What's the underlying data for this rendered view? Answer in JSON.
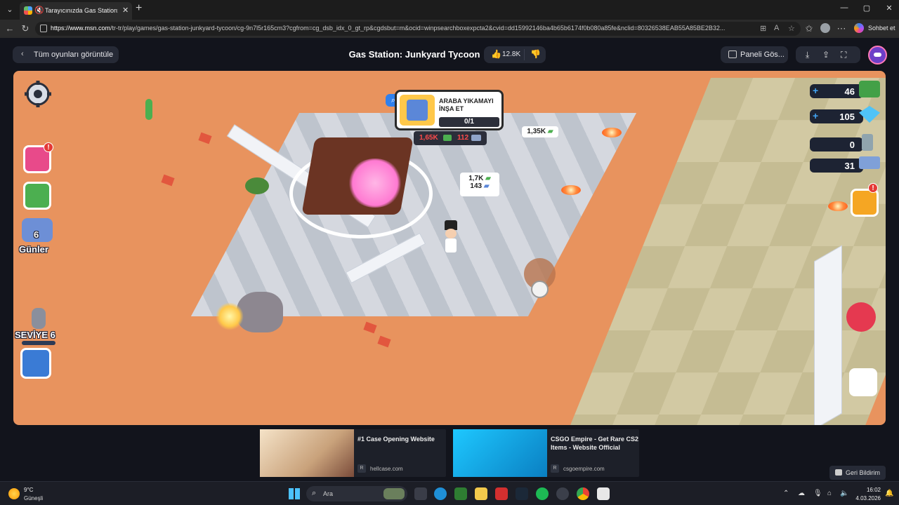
{
  "browser": {
    "tab_title": "Tarayıcınızda Gas Station: Junk",
    "url_host": "https://www.msn.com",
    "url_path": "/tr-tr/play/games/gas-station-junkyard-tycoon/cg-9n7l5r165cm3?cgfrom=cg_dsb_idx_0_gt_rp&cgdsbut=m&ocid=winpsearchboxexpcta2&cvid=dd15992146ba4b65b6174f0b080a85fe&nclid=80326538EAB55A85BE2B32...",
    "copilot_label": "Sohbet et"
  },
  "header": {
    "back_label": "Tüm oyunları görüntüle",
    "title": "Gas Station: Junkyard Tycoon",
    "like_count": "12.8K",
    "panel_label": "Paneli Gös..."
  },
  "game": {
    "hud_left": {
      "days_count": "6",
      "days_label": "Günler",
      "level_label": "SEVİYE 6",
      "shop_notif": "!",
      "quest_notif": "!"
    },
    "resources": {
      "cash": "46",
      "gems": "105",
      "tools": "0",
      "metal": "31"
    },
    "build_card": {
      "title": "ARABA YIKAMAYI İNŞA ET",
      "progress": "0/1",
      "cost_cash": "1,65K",
      "cost_metal": "112"
    },
    "price_tags": {
      "station_cash": "1,35K",
      "pile_cash": "1,7K",
      "pile_metal": "143"
    }
  },
  "ads": [
    {
      "title": "#1 Case Opening Website",
      "source": "hellcase.com",
      "badge": "R"
    },
    {
      "title": "CSGO Empire - Get Rare CS2 Items - Website Official",
      "source": "csgoempire.com",
      "badge": "R"
    }
  ],
  "feedback_label": "Geri Bildirim",
  "taskbar": {
    "weather_temp": "9°C",
    "weather_desc": "Güneşli",
    "search_placeholder": "Ara",
    "time": "16:02",
    "date": "4.03.2026"
  },
  "colors": {
    "accent": "#2f80ed",
    "sand": "#e8935e",
    "alert": "#e53935",
    "cost_red": "#ff4b4b"
  },
  "icons": [
    "settings-gear-icon",
    "shop-icon",
    "tv-ad-icon",
    "days-badge-icon",
    "wrench-icon",
    "player-avatar-icon",
    "quest-clipboard-icon",
    "car-wash-icon",
    "map-icon",
    "cash-icon",
    "gem-icon",
    "tool-icon",
    "metal-icon"
  ]
}
